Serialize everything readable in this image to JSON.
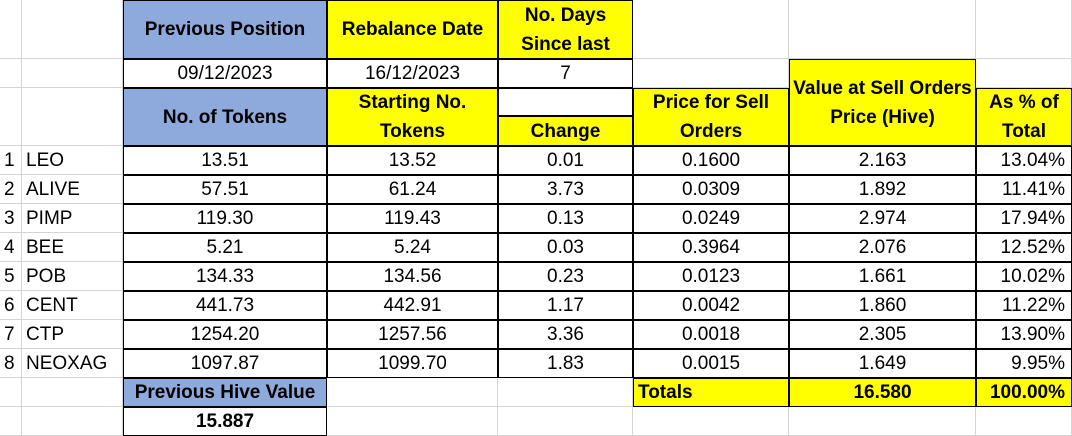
{
  "header": {
    "previous_position": "Previous Position",
    "rebalance_date": "Rebalance Date",
    "no_days_since_last": "No. Days Since last",
    "value_at_sell_orders_price": "Value at Sell Orders Price (Hive)",
    "no_of_tokens": "No. of Tokens",
    "starting_no_tokens": "Starting No. Tokens",
    "change": "Change",
    "price_for_sell_orders": "Price for Sell Orders",
    "as_pct_of_total": "As % of Total"
  },
  "dates": {
    "previous_date": "09/12/2023",
    "rebalance_date": "16/12/2023",
    "days": "7"
  },
  "rows": [
    {
      "idx": "1",
      "token": "LEO",
      "prev": "13.51",
      "start": "13.52",
      "change": "0.01",
      "price": "0.1600",
      "value": "2.163",
      "pct": "13.04%"
    },
    {
      "idx": "2",
      "token": "ALIVE",
      "prev": "57.51",
      "start": "61.24",
      "change": "3.73",
      "price": "0.0309",
      "value": "1.892",
      "pct": "11.41%"
    },
    {
      "idx": "3",
      "token": "PIMP",
      "prev": "119.30",
      "start": "119.43",
      "change": "0.13",
      "price": "0.0249",
      "value": "2.974",
      "pct": "17.94%"
    },
    {
      "idx": "4",
      "token": "BEE",
      "prev": "5.21",
      "start": "5.24",
      "change": "0.03",
      "price": "0.3964",
      "value": "2.076",
      "pct": "12.52%"
    },
    {
      "idx": "5",
      "token": "POB",
      "prev": "134.33",
      "start": "134.56",
      "change": "0.23",
      "price": "0.0123",
      "value": "1.661",
      "pct": "10.02%"
    },
    {
      "idx": "6",
      "token": "CENT",
      "prev": "441.73",
      "start": "442.91",
      "change": "1.17",
      "price": "0.0042",
      "value": "1.860",
      "pct": "11.22%"
    },
    {
      "idx": "7",
      "token": "CTP",
      "prev": "1254.20",
      "start": "1257.56",
      "change": "3.36",
      "price": "0.0018",
      "value": "2.305",
      "pct": "13.90%"
    },
    {
      "idx": "8",
      "token": "NEOXAG",
      "prev": "1097.87",
      "start": "1099.70",
      "change": "1.83",
      "price": "0.0015",
      "value": "1.649",
      "pct": "9.95%"
    }
  ],
  "footer": {
    "previous_hive_value_label": "Previous Hive Value",
    "previous_hive_value": "15.887",
    "totals_label": "Totals",
    "totals_value": "16.580",
    "totals_pct": "100.00%"
  },
  "colors": {
    "header_blue": "#8ea9db",
    "highlight_yellow": "#ffff00",
    "gridline": "#d4d4d4"
  }
}
